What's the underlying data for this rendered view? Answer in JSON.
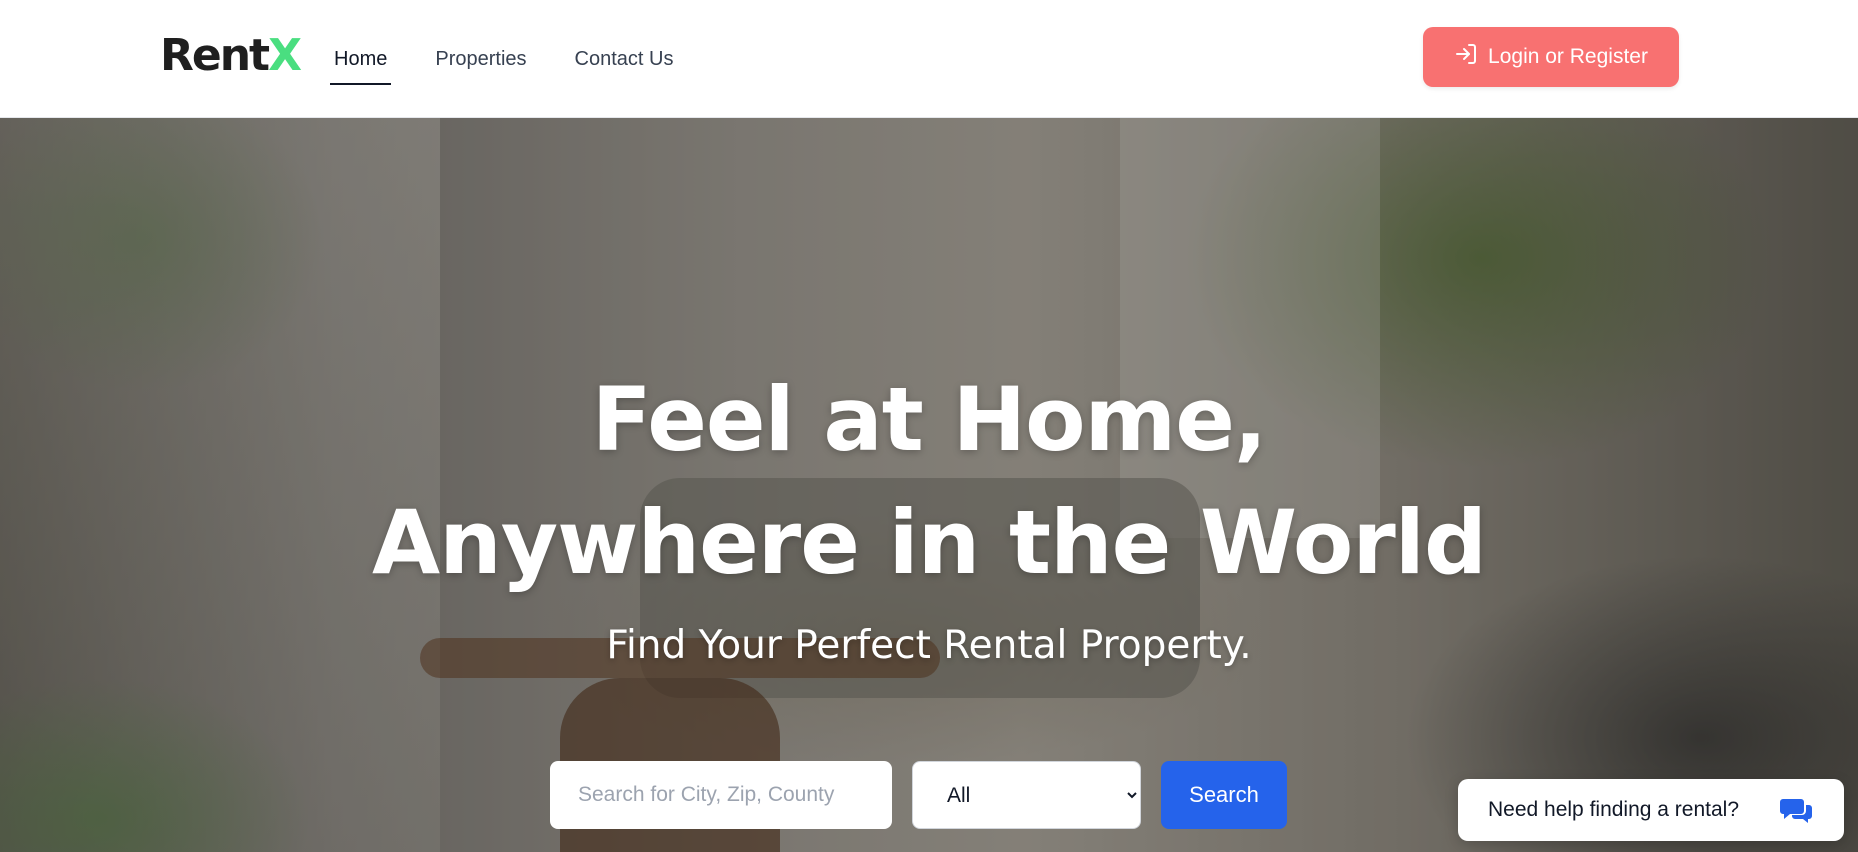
{
  "brand": {
    "name_main": "Rent",
    "name_accent": "X"
  },
  "nav": {
    "items": [
      {
        "label": "Home",
        "active": true
      },
      {
        "label": "Properties",
        "active": false
      },
      {
        "label": "Contact Us",
        "active": false
      }
    ]
  },
  "header": {
    "login_label": "Login or Register"
  },
  "hero": {
    "title_line1": "Feel at Home,",
    "title_line2": "Anywhere in the World",
    "subtitle": "Find Your Perfect Rental Property."
  },
  "search": {
    "placeholder": "Search for City, Zip, County",
    "value": "",
    "type_selected": "All",
    "button_label": "Search"
  },
  "help": {
    "label": "Need help finding a rental?"
  },
  "colors": {
    "accent_green": "#4ade80",
    "login_button": "#f87171",
    "search_button": "#2563eb"
  },
  "icons": {
    "login": "sign-in-icon",
    "chat": "chat-bubbles-icon",
    "select": "chevron-down-icon"
  }
}
